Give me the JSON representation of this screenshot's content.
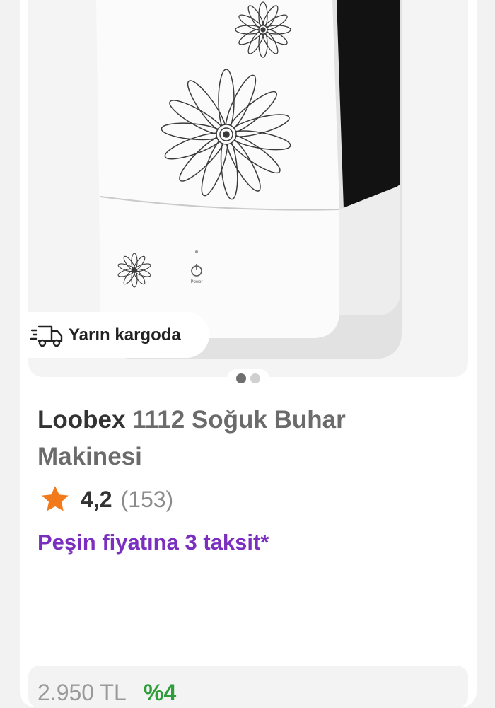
{
  "product": {
    "brand": "Loobex",
    "title_rest": " 1112 Soğuk Buhar Makinesi",
    "rating": "4,2",
    "review_count": "(153)",
    "installment_text": "Peşin fiyatına 3 taksit*",
    "shipping_badge": "Yarın kargoda",
    "price_old": "2.950 TL",
    "discount": "%4",
    "image_index": 1,
    "image_total": 2,
    "device_power_label": "Power"
  },
  "icons": {
    "shipping": "fast-delivery-truck-icon",
    "rating": "star-icon"
  },
  "colors": {
    "installment": "#7a2fbf",
    "star": "#f27a1a",
    "discount": "#2f9e3a"
  }
}
